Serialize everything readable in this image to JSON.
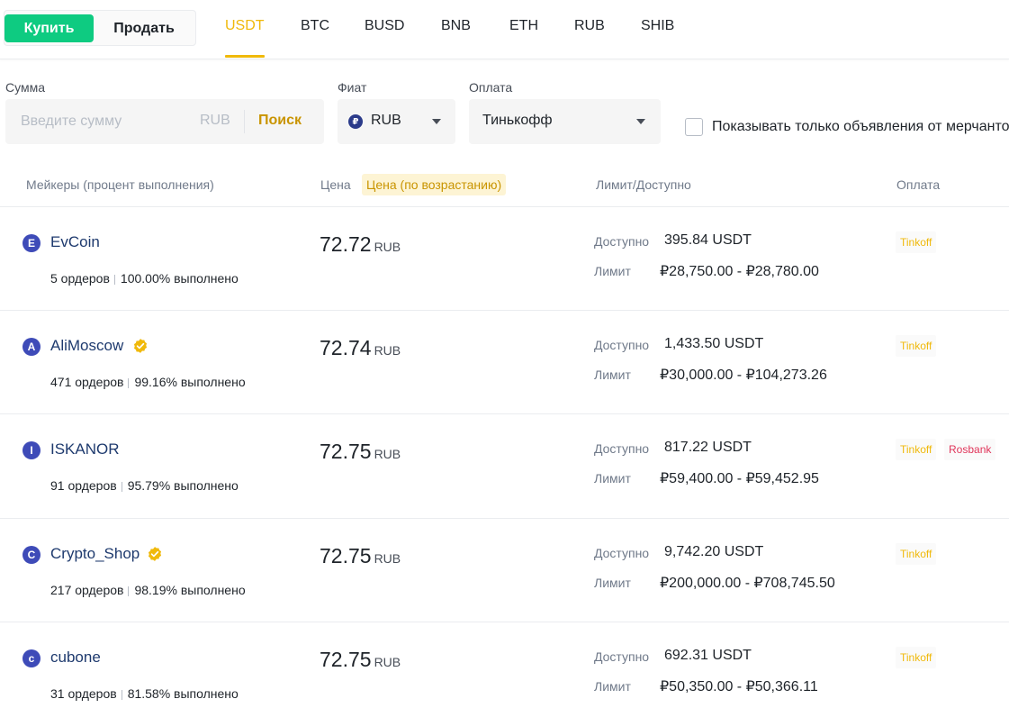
{
  "header": {
    "buy_label": "Купить",
    "sell_label": "Продать",
    "assets": [
      "USDT",
      "BTC",
      "BUSD",
      "BNB",
      "ETH",
      "RUB",
      "SHIB"
    ],
    "active_asset": "USDT"
  },
  "filters": {
    "amount_label": "Сумма",
    "amount_placeholder": "Введите сумму",
    "amount_unit": "RUB",
    "search_label": "Поиск",
    "fiat_label": "Фиат",
    "fiat_value": "RUB",
    "payment_label": "Оплата",
    "payment_value": "Тинькофф",
    "merchant_only_label": "Показывать только объявления от мерчантов"
  },
  "table": {
    "col_makers": "Мейкеры (процент выполнения)",
    "col_price": "Цена",
    "col_price_sort": "Цена (по возрастанию)",
    "col_limit": "Лимит/Доступно",
    "col_payment": "Оплата",
    "available_label": "Доступно",
    "limit_label": "Лимит",
    "rows": [
      {
        "initial": "E",
        "name": "EvCoin",
        "verified": false,
        "orders": "5 ордеров",
        "completion": "100.00% выполнено",
        "price": "72.72",
        "currency": "RUB",
        "available": "395.84 USDT",
        "limit": "₽28,750.00 - ₽28,780.00",
        "payments": [
          "Tinkoff"
        ]
      },
      {
        "initial": "A",
        "name": "AliMoscow",
        "verified": true,
        "orders": "471 ордеров",
        "completion": "99.16% выполнено",
        "price": "72.74",
        "currency": "RUB",
        "available": "1,433.50 USDT",
        "limit": "₽30,000.00 - ₽104,273.26",
        "payments": [
          "Tinkoff"
        ]
      },
      {
        "initial": "I",
        "name": "ISKANOR",
        "verified": false,
        "orders": "91 ордеров",
        "completion": "95.79% выполнено",
        "price": "72.75",
        "currency": "RUB",
        "available": "817.22 USDT",
        "limit": "₽59,400.00 - ₽59,452.95",
        "payments": [
          "Tinkoff",
          "Rosbank"
        ]
      },
      {
        "initial": "C",
        "name": "Crypto_Shop",
        "verified": true,
        "orders": "217 ордеров",
        "completion": "98.19% выполнено",
        "price": "72.75",
        "currency": "RUB",
        "available": "9,742.20 USDT",
        "limit": "₽200,000.00 - ₽708,745.50",
        "payments": [
          "Tinkoff"
        ]
      },
      {
        "initial": "c",
        "name": "cubone",
        "verified": false,
        "orders": "31 ордеров",
        "completion": "81.58% выполнено",
        "price": "72.75",
        "currency": "RUB",
        "available": "692.31 USDT",
        "limit": "₽50,350.00 - ₽50,366.11",
        "payments": [
          "Tinkoff"
        ]
      }
    ]
  },
  "icons": {
    "fiat_icon": "ruble-coin-icon",
    "dropdown_icon": "caret-down-icon",
    "verified_icon": "verified-badge-icon"
  },
  "colors": {
    "buy_green": "#0ecb81",
    "accent_yellow": "#f0b90b",
    "rosbank_red": "#e0355a",
    "avatar_blue": "#3e4bb8"
  }
}
